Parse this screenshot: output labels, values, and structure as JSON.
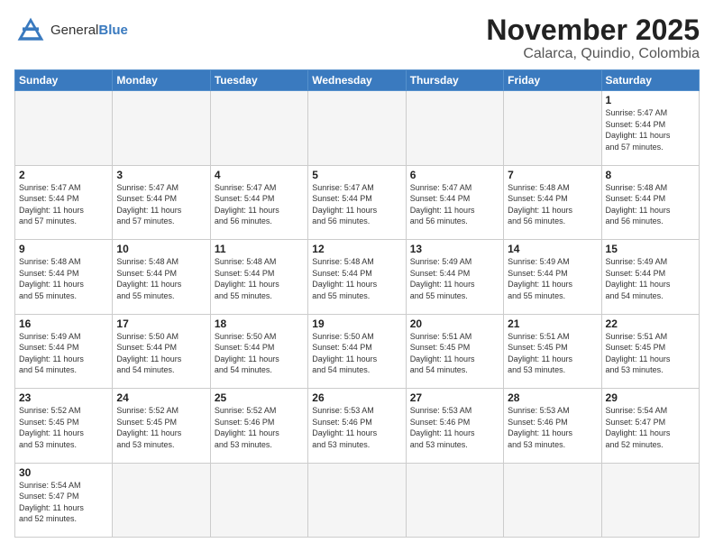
{
  "logo": {
    "line1": "General",
    "line2": "Blue"
  },
  "title": "November 2025",
  "subtitle": "Calarca, Quindio, Colombia",
  "days_of_week": [
    "Sunday",
    "Monday",
    "Tuesday",
    "Wednesday",
    "Thursday",
    "Friday",
    "Saturday"
  ],
  "weeks": [
    [
      {
        "num": "",
        "info": ""
      },
      {
        "num": "",
        "info": ""
      },
      {
        "num": "",
        "info": ""
      },
      {
        "num": "",
        "info": ""
      },
      {
        "num": "",
        "info": ""
      },
      {
        "num": "",
        "info": ""
      },
      {
        "num": "1",
        "info": "Sunrise: 5:47 AM\nSunset: 5:44 PM\nDaylight: 11 hours\nand 57 minutes."
      }
    ],
    [
      {
        "num": "2",
        "info": "Sunrise: 5:47 AM\nSunset: 5:44 PM\nDaylight: 11 hours\nand 57 minutes."
      },
      {
        "num": "3",
        "info": "Sunrise: 5:47 AM\nSunset: 5:44 PM\nDaylight: 11 hours\nand 57 minutes."
      },
      {
        "num": "4",
        "info": "Sunrise: 5:47 AM\nSunset: 5:44 PM\nDaylight: 11 hours\nand 56 minutes."
      },
      {
        "num": "5",
        "info": "Sunrise: 5:47 AM\nSunset: 5:44 PM\nDaylight: 11 hours\nand 56 minutes."
      },
      {
        "num": "6",
        "info": "Sunrise: 5:47 AM\nSunset: 5:44 PM\nDaylight: 11 hours\nand 56 minutes."
      },
      {
        "num": "7",
        "info": "Sunrise: 5:48 AM\nSunset: 5:44 PM\nDaylight: 11 hours\nand 56 minutes."
      },
      {
        "num": "8",
        "info": "Sunrise: 5:48 AM\nSunset: 5:44 PM\nDaylight: 11 hours\nand 56 minutes."
      }
    ],
    [
      {
        "num": "9",
        "info": "Sunrise: 5:48 AM\nSunset: 5:44 PM\nDaylight: 11 hours\nand 55 minutes."
      },
      {
        "num": "10",
        "info": "Sunrise: 5:48 AM\nSunset: 5:44 PM\nDaylight: 11 hours\nand 55 minutes."
      },
      {
        "num": "11",
        "info": "Sunrise: 5:48 AM\nSunset: 5:44 PM\nDaylight: 11 hours\nand 55 minutes."
      },
      {
        "num": "12",
        "info": "Sunrise: 5:48 AM\nSunset: 5:44 PM\nDaylight: 11 hours\nand 55 minutes."
      },
      {
        "num": "13",
        "info": "Sunrise: 5:49 AM\nSunset: 5:44 PM\nDaylight: 11 hours\nand 55 minutes."
      },
      {
        "num": "14",
        "info": "Sunrise: 5:49 AM\nSunset: 5:44 PM\nDaylight: 11 hours\nand 55 minutes."
      },
      {
        "num": "15",
        "info": "Sunrise: 5:49 AM\nSunset: 5:44 PM\nDaylight: 11 hours\nand 54 minutes."
      }
    ],
    [
      {
        "num": "16",
        "info": "Sunrise: 5:49 AM\nSunset: 5:44 PM\nDaylight: 11 hours\nand 54 minutes."
      },
      {
        "num": "17",
        "info": "Sunrise: 5:50 AM\nSunset: 5:44 PM\nDaylight: 11 hours\nand 54 minutes."
      },
      {
        "num": "18",
        "info": "Sunrise: 5:50 AM\nSunset: 5:44 PM\nDaylight: 11 hours\nand 54 minutes."
      },
      {
        "num": "19",
        "info": "Sunrise: 5:50 AM\nSunset: 5:44 PM\nDaylight: 11 hours\nand 54 minutes."
      },
      {
        "num": "20",
        "info": "Sunrise: 5:51 AM\nSunset: 5:45 PM\nDaylight: 11 hours\nand 54 minutes."
      },
      {
        "num": "21",
        "info": "Sunrise: 5:51 AM\nSunset: 5:45 PM\nDaylight: 11 hours\nand 53 minutes."
      },
      {
        "num": "22",
        "info": "Sunrise: 5:51 AM\nSunset: 5:45 PM\nDaylight: 11 hours\nand 53 minutes."
      }
    ],
    [
      {
        "num": "23",
        "info": "Sunrise: 5:52 AM\nSunset: 5:45 PM\nDaylight: 11 hours\nand 53 minutes."
      },
      {
        "num": "24",
        "info": "Sunrise: 5:52 AM\nSunset: 5:45 PM\nDaylight: 11 hours\nand 53 minutes."
      },
      {
        "num": "25",
        "info": "Sunrise: 5:52 AM\nSunset: 5:46 PM\nDaylight: 11 hours\nand 53 minutes."
      },
      {
        "num": "26",
        "info": "Sunrise: 5:53 AM\nSunset: 5:46 PM\nDaylight: 11 hours\nand 53 minutes."
      },
      {
        "num": "27",
        "info": "Sunrise: 5:53 AM\nSunset: 5:46 PM\nDaylight: 11 hours\nand 53 minutes."
      },
      {
        "num": "28",
        "info": "Sunrise: 5:53 AM\nSunset: 5:46 PM\nDaylight: 11 hours\nand 53 minutes."
      },
      {
        "num": "29",
        "info": "Sunrise: 5:54 AM\nSunset: 5:47 PM\nDaylight: 11 hours\nand 52 minutes."
      }
    ],
    [
      {
        "num": "30",
        "info": "Sunrise: 5:54 AM\nSunset: 5:47 PM\nDaylight: 11 hours\nand 52 minutes."
      },
      {
        "num": "",
        "info": ""
      },
      {
        "num": "",
        "info": ""
      },
      {
        "num": "",
        "info": ""
      },
      {
        "num": "",
        "info": ""
      },
      {
        "num": "",
        "info": ""
      },
      {
        "num": "",
        "info": ""
      }
    ]
  ]
}
